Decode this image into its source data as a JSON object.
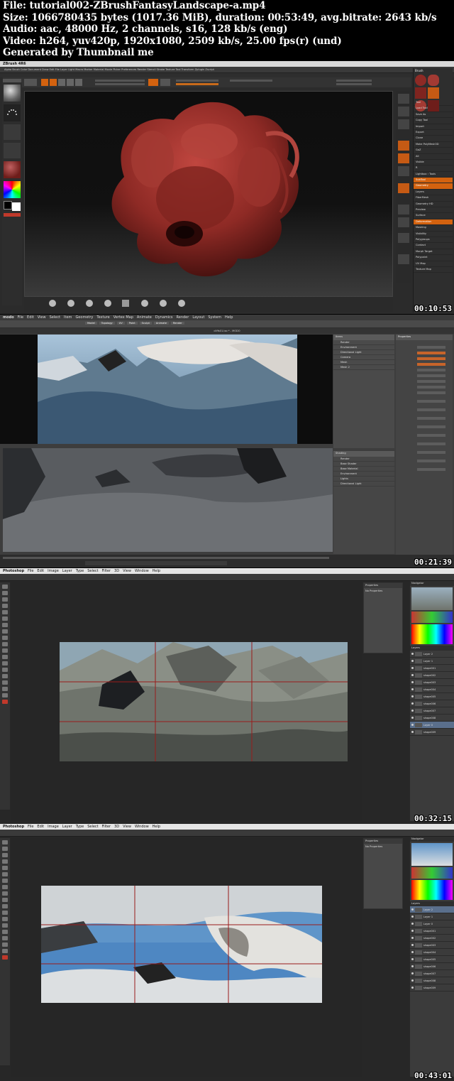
{
  "header": {
    "file": "File: tutorial002-ZBrushFantasyLandscape-a.mp4",
    "size": "Size: 1066780435 bytes (1017.36 MiB), duration: 00:53:49, avg.bitrate: 2643 kb/s",
    "audio": "Audio: aac, 48000 Hz, 2 channels, s16, 128 kb/s (eng)",
    "video": "Video: h264, yuv420p, 1920x1080, 2509 kb/s, 25.00 fps(r) (und)",
    "generator": "Generated by Thumbnail me"
  },
  "frames": [
    {
      "id": "zbrush",
      "timestamp": "00:10:53"
    },
    {
      "id": "modo",
      "timestamp": "00:21:39"
    },
    {
      "id": "photoshop-1",
      "timestamp": "00:32:15"
    },
    {
      "id": "photoshop-2",
      "timestamp": "00:43:01"
    }
  ],
  "zbrush": {
    "title": "ZBrush 4R6",
    "menu_items": [
      "Alpha",
      "Brush",
      "Color",
      "Document",
      "Draw",
      "Edit",
      "File",
      "Layer",
      "Light",
      "Macro",
      "Marker",
      "Material",
      "Movie",
      "Picker",
      "Preferences",
      "Render",
      "Stencil",
      "Stroke",
      "Texture",
      "Tool",
      "Transform",
      "Zplugin",
      "Zscript"
    ],
    "right_title": "Brush",
    "right_items": [
      "Tool",
      "Load Tool",
      "Save As",
      "Copy Tool",
      "Import",
      "Export",
      "Clone",
      "Make PolyMesh3D",
      "GoZ",
      "All",
      "Visible",
      "R",
      "Lightbox › Tools",
      "SubTool",
      "Geometry",
      "Layers",
      "FiberMesh",
      "Geometry HD",
      "Preview",
      "Surface",
      "Deformation",
      "Masking",
      "Visibility",
      "Polygroups",
      "Contact",
      "Morph Target",
      "Polypaint",
      "UV Map",
      "Texture Map"
    ],
    "colors": {
      "accent": "#d3620f",
      "sculpt": "#8e2a25"
    }
  },
  "modo": {
    "app": "modo",
    "menu_items": [
      "File",
      "Edit",
      "View",
      "Select",
      "Item",
      "Geometry",
      "Texture",
      "Vertex Map",
      "Animate",
      "Dynamics",
      "Render",
      "Layout",
      "System",
      "Help"
    ],
    "window_title": "cliffs01.lxo * - MODO",
    "tabs": [
      "Model",
      "Topology",
      "UV",
      "Paint",
      "Sculpt",
      "Animate",
      "Render"
    ],
    "item_list": [
      "Render",
      "Environment",
      "Directional Light",
      "Camera",
      "Mesh",
      "Mesh 2"
    ],
    "shader_tree": [
      "Render",
      "Base Shader",
      "Base Material",
      "Environment",
      "Lights",
      "Directional Light"
    ],
    "properties_title": "Properties"
  },
  "photoshop": {
    "app": "Photoshop",
    "menu_items": [
      "File",
      "Edit",
      "Image",
      "Layer",
      "Type",
      "Select",
      "Filter",
      "3D",
      "View",
      "Window",
      "Help"
    ],
    "properties_label": "Properties",
    "properties_empty": "No Properties",
    "navigator_label": "Navigator",
    "layers_label": "Layers",
    "layers_1": [
      "Layer 2",
      "Layer 1",
      "shape001",
      "shape002",
      "shape003",
      "shape004",
      "shape005",
      "shape006",
      "shape007",
      "shape008",
      "Layer 0",
      "shape009"
    ],
    "layers_2": [
      "Layer 2",
      "Layer 1",
      "Layer 0",
      "shape001",
      "shape002",
      "shape003",
      "shape004",
      "shape005",
      "shape006",
      "shape007",
      "shape008",
      "shape009"
    ],
    "guide_color": "#9a1b1b"
  }
}
